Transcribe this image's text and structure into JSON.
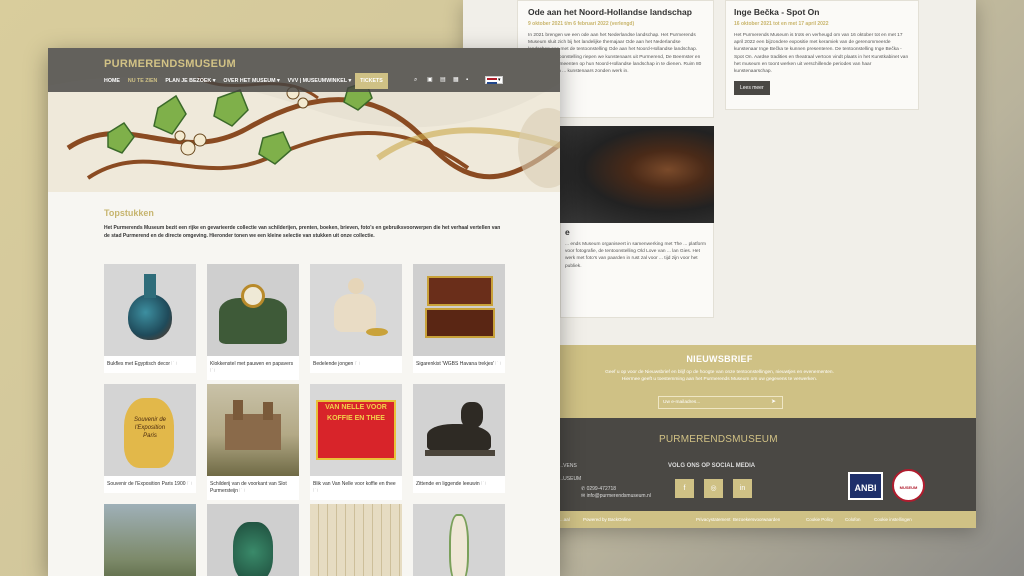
{
  "back": {
    "cards": [
      {
        "title": "Ode aan het Noord-Hollandse landschap",
        "date": "9 oktober 2021 t/m 6 februari 2022 (verlengd)",
        "text": "In 2021 brengen we een ode aan het Nederlandse landschap. Het Purmerends Museum sluit zich bij het landelijke themajaar Ode aan het Nederlandse landschap aan met de tentoonstelling Ode aan het Noord-Hollandse landschap. Voor deze tentoonstelling riepen we kunstenaars uit Purmerend, De Beemster en omliggende gemeenten op hun Noord-Hollandse landschap in te dienen. Ruim 80 kunstenaars en ... kunstenaars zonden werk in."
      },
      {
        "title": "Inge Bečka - Spot On",
        "date": "16 oktober 2021 tot en met 17 april 2022",
        "text": "Het Purmerends Museum is trots en verheugd om van 16 oktober tot en met 17 april 2022 een bijzondere expositie met keramiek van de gerenommeerde kunstenaar Inge Bečka te kunnen presenteren. De tentoonstelling Inge Bečka - Spot On. Aardse tradities en theatraal vertoon vindt plaats in het Kunstkabinet van het museum en toont werken uit verschillende periodes van haar kunstenaarschap.",
        "button": "Lees meer"
      },
      {
        "title": "e",
        "text": "... ends Museum organiseert in samenwerking met The ... platform voor fotografie, de tentoonstelling Old Love van ... lan Gies. Het werk met foto's van paarden in rust zal voor ... tijd zijn voor het publiek."
      }
    ],
    "newsletter": {
      "title": "NIEUWSBRIEF",
      "text1": "Geef u op voor de Nieuwsbrief en blijf op de hoogte van onze tentoonstellingen, nieuwtjes en evenementen.",
      "text2": "Hiermee geeft u toestemming aan het Purmerends Museum om uw gegevens te verwerken.",
      "placeholder": "Uw e-mailadres..."
    },
    "footer": {
      "brand": "PURMERENDSMUSEUM",
      "openings": "...VENS",
      "museum": "...USEUM",
      "phone": "0299-472718",
      "email": "info@purmerendsmuseum.nl",
      "social_title": "VOLG ONS OP SOCIAL MEDIA",
      "social": [
        "f",
        "◎",
        "in"
      ],
      "anbi": "ANBI",
      "seal": "GEREGISTREERD MUSEUM",
      "links": [
        "...aal",
        "Powered by BackOnline",
        "Privacystatement",
        "Bezoekersvoorwaarden",
        "Cookie Policy",
        "Colofon",
        "Cookie instellingen"
      ]
    }
  },
  "front": {
    "brand": "PURMERENDSMUSEUM",
    "nav": [
      "HOME",
      "NU TE ZIEN",
      "PLAN JE BEZOEK ▾",
      "OVER HET MUSEUM ▾",
      "VVV | MUSEUMWINKEL ▾",
      "TICKETS"
    ],
    "heading": "Topstukken",
    "intro": "Het Purmerends Museum bezit een rijke en gevarieerde collectie van schilderijen, prenten, boeken, brieven, foto's en gebruiksvoorwerpen die het verhaal vertellen van de stad Purmerend en de directe omgeving. Hieronder tonen we een kleine selectie van stukken uit onze collectie.",
    "tiles": [
      {
        "caption": "Bukfles met Egyptisch decor 🗀"
      },
      {
        "caption": "Klokkenstel met pauwen en papavers 🗀"
      },
      {
        "caption": "Bedelende jongen 🗀"
      },
      {
        "caption": "Sigarenkist 'WGBS Havana trekjes' 🗀"
      },
      {
        "caption": "Souvenir de l'Exposition Paris 1900 🗀"
      },
      {
        "caption": "Schilderij van de voorkant van Slot Purmersteijn 🗀"
      },
      {
        "caption": "Blik van Van Nelle voor koffie en thee 🗀"
      },
      {
        "caption": "Zittende en liggende leeuwin 🗀"
      },
      {
        "caption": ""
      },
      {
        "caption": ""
      },
      {
        "caption": ""
      },
      {
        "caption": ""
      }
    ],
    "tin_text": "VAN NELLE VOOR KOFFIE EN THEE",
    "jug_text": "Souvenir de l'Exposition Paris"
  }
}
